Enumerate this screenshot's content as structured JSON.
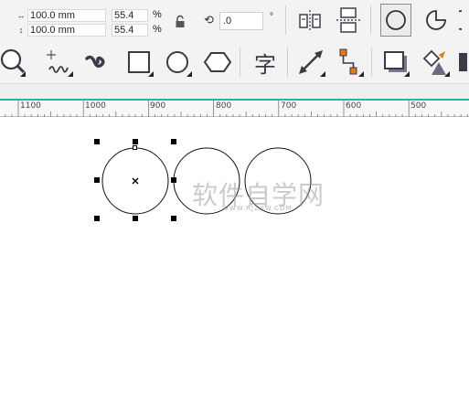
{
  "property_bar": {
    "width_value": "100.0 mm",
    "height_value": "100.0 mm",
    "scale_x": "55.4",
    "scale_y": "55.4",
    "percent_symbol": "%",
    "rotation_value": ".0",
    "degree_symbol": "°"
  },
  "toolbox": {
    "text_tool_glyph": "字"
  },
  "ruler": {
    "ticks": [
      "1100",
      "1000",
      "900",
      "800",
      "700",
      "600",
      "500"
    ]
  },
  "canvas": {
    "watermark_text": "软件自学网",
    "watermark_subtext": "WWW.RJZXW.COM"
  },
  "colors": {
    "accent_teal": "#28b3aa",
    "toolbar_bg": "#f3f3f3",
    "orange_node": "#e87a10"
  }
}
